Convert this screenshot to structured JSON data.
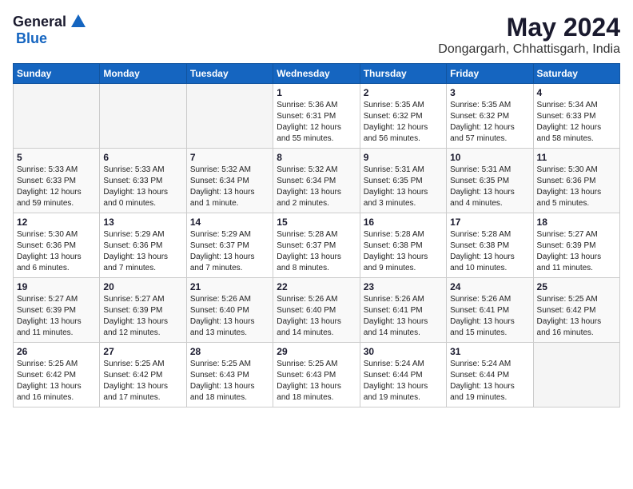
{
  "logo": {
    "general": "General",
    "blue": "Blue"
  },
  "header": {
    "month": "May 2024",
    "location": "Dongargarh, Chhattisgarh, India"
  },
  "weekdays": [
    "Sunday",
    "Monday",
    "Tuesday",
    "Wednesday",
    "Thursday",
    "Friday",
    "Saturday"
  ],
  "weeks": [
    [
      {
        "day": "",
        "info": ""
      },
      {
        "day": "",
        "info": ""
      },
      {
        "day": "",
        "info": ""
      },
      {
        "day": "1",
        "info": "Sunrise: 5:36 AM\nSunset: 6:31 PM\nDaylight: 12 hours\nand 55 minutes."
      },
      {
        "day": "2",
        "info": "Sunrise: 5:35 AM\nSunset: 6:32 PM\nDaylight: 12 hours\nand 56 minutes."
      },
      {
        "day": "3",
        "info": "Sunrise: 5:35 AM\nSunset: 6:32 PM\nDaylight: 12 hours\nand 57 minutes."
      },
      {
        "day": "4",
        "info": "Sunrise: 5:34 AM\nSunset: 6:33 PM\nDaylight: 12 hours\nand 58 minutes."
      }
    ],
    [
      {
        "day": "5",
        "info": "Sunrise: 5:33 AM\nSunset: 6:33 PM\nDaylight: 12 hours\nand 59 minutes."
      },
      {
        "day": "6",
        "info": "Sunrise: 5:33 AM\nSunset: 6:33 PM\nDaylight: 13 hours\nand 0 minutes."
      },
      {
        "day": "7",
        "info": "Sunrise: 5:32 AM\nSunset: 6:34 PM\nDaylight: 13 hours\nand 1 minute."
      },
      {
        "day": "8",
        "info": "Sunrise: 5:32 AM\nSunset: 6:34 PM\nDaylight: 13 hours\nand 2 minutes."
      },
      {
        "day": "9",
        "info": "Sunrise: 5:31 AM\nSunset: 6:35 PM\nDaylight: 13 hours\nand 3 minutes."
      },
      {
        "day": "10",
        "info": "Sunrise: 5:31 AM\nSunset: 6:35 PM\nDaylight: 13 hours\nand 4 minutes."
      },
      {
        "day": "11",
        "info": "Sunrise: 5:30 AM\nSunset: 6:36 PM\nDaylight: 13 hours\nand 5 minutes."
      }
    ],
    [
      {
        "day": "12",
        "info": "Sunrise: 5:30 AM\nSunset: 6:36 PM\nDaylight: 13 hours\nand 6 minutes."
      },
      {
        "day": "13",
        "info": "Sunrise: 5:29 AM\nSunset: 6:36 PM\nDaylight: 13 hours\nand 7 minutes."
      },
      {
        "day": "14",
        "info": "Sunrise: 5:29 AM\nSunset: 6:37 PM\nDaylight: 13 hours\nand 7 minutes."
      },
      {
        "day": "15",
        "info": "Sunrise: 5:28 AM\nSunset: 6:37 PM\nDaylight: 13 hours\nand 8 minutes."
      },
      {
        "day": "16",
        "info": "Sunrise: 5:28 AM\nSunset: 6:38 PM\nDaylight: 13 hours\nand 9 minutes."
      },
      {
        "day": "17",
        "info": "Sunrise: 5:28 AM\nSunset: 6:38 PM\nDaylight: 13 hours\nand 10 minutes."
      },
      {
        "day": "18",
        "info": "Sunrise: 5:27 AM\nSunset: 6:39 PM\nDaylight: 13 hours\nand 11 minutes."
      }
    ],
    [
      {
        "day": "19",
        "info": "Sunrise: 5:27 AM\nSunset: 6:39 PM\nDaylight: 13 hours\nand 11 minutes."
      },
      {
        "day": "20",
        "info": "Sunrise: 5:27 AM\nSunset: 6:39 PM\nDaylight: 13 hours\nand 12 minutes."
      },
      {
        "day": "21",
        "info": "Sunrise: 5:26 AM\nSunset: 6:40 PM\nDaylight: 13 hours\nand 13 minutes."
      },
      {
        "day": "22",
        "info": "Sunrise: 5:26 AM\nSunset: 6:40 PM\nDaylight: 13 hours\nand 14 minutes."
      },
      {
        "day": "23",
        "info": "Sunrise: 5:26 AM\nSunset: 6:41 PM\nDaylight: 13 hours\nand 14 minutes."
      },
      {
        "day": "24",
        "info": "Sunrise: 5:26 AM\nSunset: 6:41 PM\nDaylight: 13 hours\nand 15 minutes."
      },
      {
        "day": "25",
        "info": "Sunrise: 5:25 AM\nSunset: 6:42 PM\nDaylight: 13 hours\nand 16 minutes."
      }
    ],
    [
      {
        "day": "26",
        "info": "Sunrise: 5:25 AM\nSunset: 6:42 PM\nDaylight: 13 hours\nand 16 minutes."
      },
      {
        "day": "27",
        "info": "Sunrise: 5:25 AM\nSunset: 6:42 PM\nDaylight: 13 hours\nand 17 minutes."
      },
      {
        "day": "28",
        "info": "Sunrise: 5:25 AM\nSunset: 6:43 PM\nDaylight: 13 hours\nand 18 minutes."
      },
      {
        "day": "29",
        "info": "Sunrise: 5:25 AM\nSunset: 6:43 PM\nDaylight: 13 hours\nand 18 minutes."
      },
      {
        "day": "30",
        "info": "Sunrise: 5:24 AM\nSunset: 6:44 PM\nDaylight: 13 hours\nand 19 minutes."
      },
      {
        "day": "31",
        "info": "Sunrise: 5:24 AM\nSunset: 6:44 PM\nDaylight: 13 hours\nand 19 minutes."
      },
      {
        "day": "",
        "info": ""
      }
    ]
  ]
}
